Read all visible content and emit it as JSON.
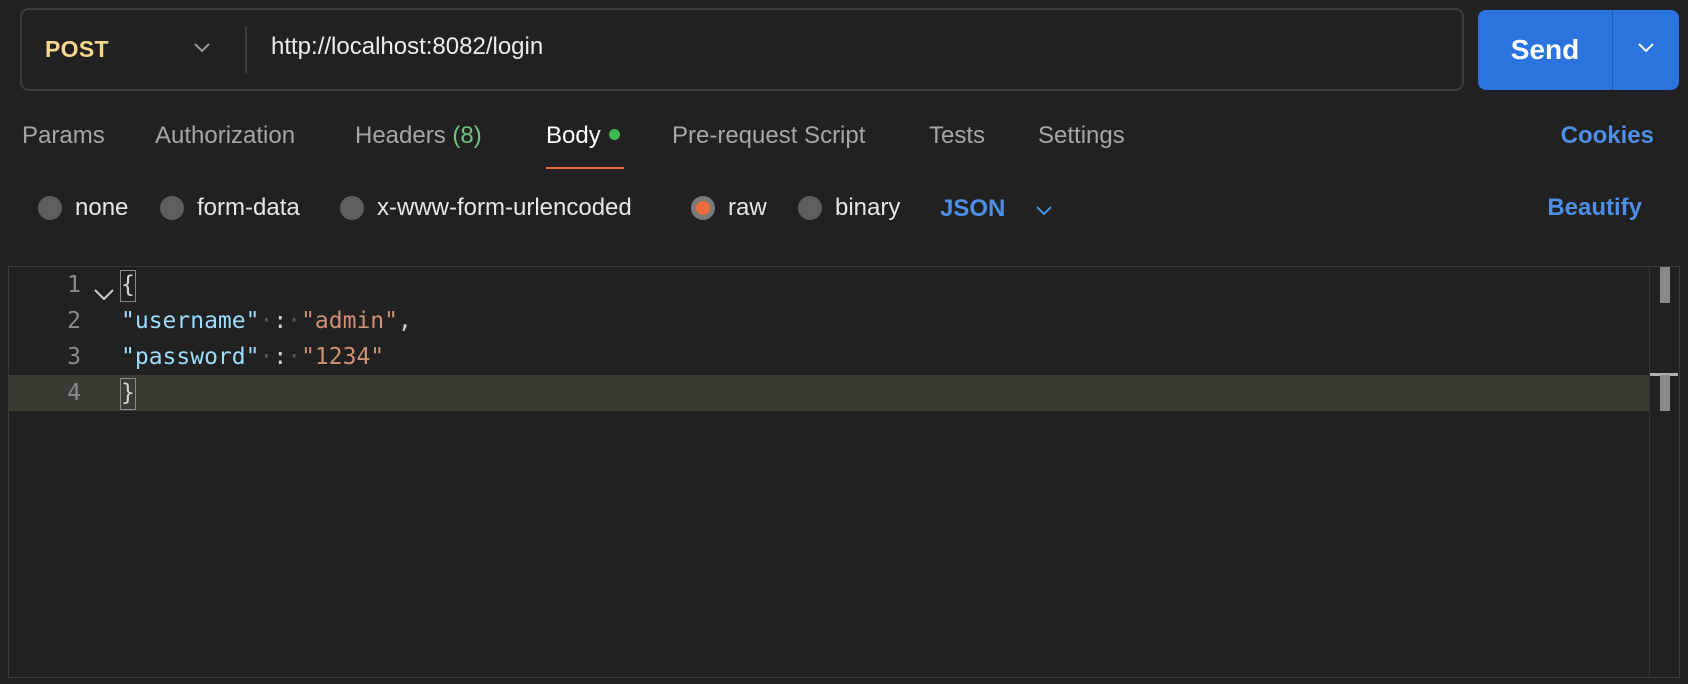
{
  "request": {
    "method": "POST",
    "url": "http://localhost:8082/login",
    "send_label": "Send"
  },
  "tabs": {
    "params": "Params",
    "authorization": "Authorization",
    "headers": "Headers",
    "headers_count": "(8)",
    "body": "Body",
    "prerequest": "Pre-request Script",
    "tests": "Tests",
    "settings": "Settings",
    "active": "Body",
    "cookies": "Cookies"
  },
  "body_types": {
    "none": "none",
    "form_data": "form-data",
    "urlencoded": "x-www-form-urlencoded",
    "raw": "raw",
    "binary": "binary",
    "selected": "raw",
    "format": "JSON",
    "beautify": "Beautify"
  },
  "editor": {
    "line_numbers": [
      "1",
      "2",
      "3",
      "4"
    ],
    "open_brace": "{",
    "close_brace": "}",
    "username_key": "\"username\"",
    "username_value": "\"admin\"",
    "password_key": "\"password\"",
    "password_value": "\"1234\""
  },
  "colors": {
    "accent": "#2b74e0",
    "method": "#f5d78e",
    "active_tab_underline": "#f26b3a",
    "link": "#4d8fe6",
    "body_dot": "#3fb950"
  }
}
